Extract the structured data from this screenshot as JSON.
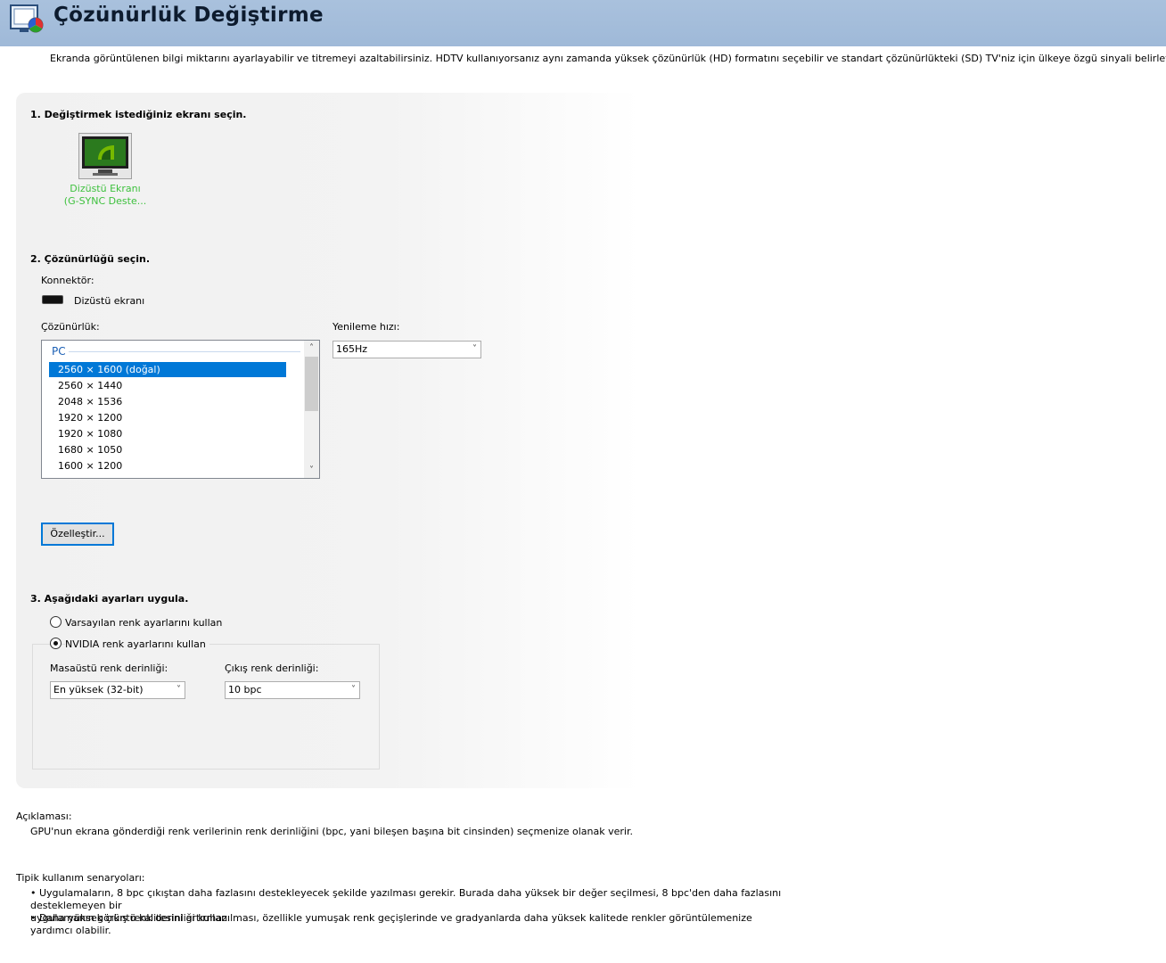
{
  "header": {
    "title": "Çözünürlük Değiştirme",
    "icon": "display-settings-icon"
  },
  "intro": "Ekranda görüntülenen bilgi miktarını ayarlayabilir ve titremeyi azaltabilirsiniz. HDTV kullanıyorsanız aynı zamanda yüksek çözünürlük (HD) formatını seçebilir ve standart çözünürlükteki (SD) TV'niz için ülkeye özgü sinyali belirleyebilirsiniz.",
  "step1": {
    "title": "1. Değiştirmek istediğiniz ekranı seçin.",
    "monitor_label_line1": "Dizüstü Ekranı",
    "monitor_label_line2": "(G-SYNC Deste...",
    "monitor_icon": "nvidia-monitor-icon",
    "accent": "#3ec13e"
  },
  "step2": {
    "title": "2. Çözünürlüğü seçin.",
    "connector_label": "Konnektör:",
    "connector_value": "Dizüstü ekranı",
    "resolution_label": "Çözünürlük:",
    "refresh_label": "Yenileme hızı:",
    "refresh_value": "165Hz",
    "group": "PC",
    "resolutions": [
      "2560 × 1600 (doğal)",
      "2560 × 1440",
      "2048 × 1536",
      "1920 × 1200",
      "1920 × 1080",
      "1680 × 1050",
      "1600 × 1200"
    ],
    "customize_button": "Özelleştir..."
  },
  "step3": {
    "title": "3. Aşağıdaki ayarları uygula.",
    "radio_default": "Varsayılan renk ayarlarını kullan",
    "radio_nvidia": "NVIDIA renk ayarlarını kullan",
    "desktop_depth_label": "Masaüstü renk derinliği:",
    "desktop_depth_value": "En yüksek (32-bit)",
    "output_depth_label": "Çıkış renk derinliği:",
    "output_depth_value": "10 bpc"
  },
  "description": {
    "heading": "Açıklaması:",
    "text": "GPU'nun ekrana gönderdiği renk verilerinin renk derinliğini (bpc, yani bileşen başına bit cinsinden) seçmenize olanak verir."
  },
  "scenarios": {
    "heading": "Tipik kullanım senaryoları:",
    "bullet1_line1": "• Uygulamaların, 8 bpc çıkıştan daha fazlasını destekleyecek şekilde yazılması gerekir. Burada daha yüksek bir değer seçilmesi, 8 bpc'den daha fazlasını desteklemeyen bir",
    "bullet1_line2": "uygulamanın görüntü kalitesini artırmaz.",
    "bullet2": "• Daha yüksek çıkış renk derinliği kullanılması, özellikle yumuşak renk geçişlerinde ve gradyanlarda daha yüksek kalitede renkler görüntülemenize yardımcı olabilir."
  }
}
